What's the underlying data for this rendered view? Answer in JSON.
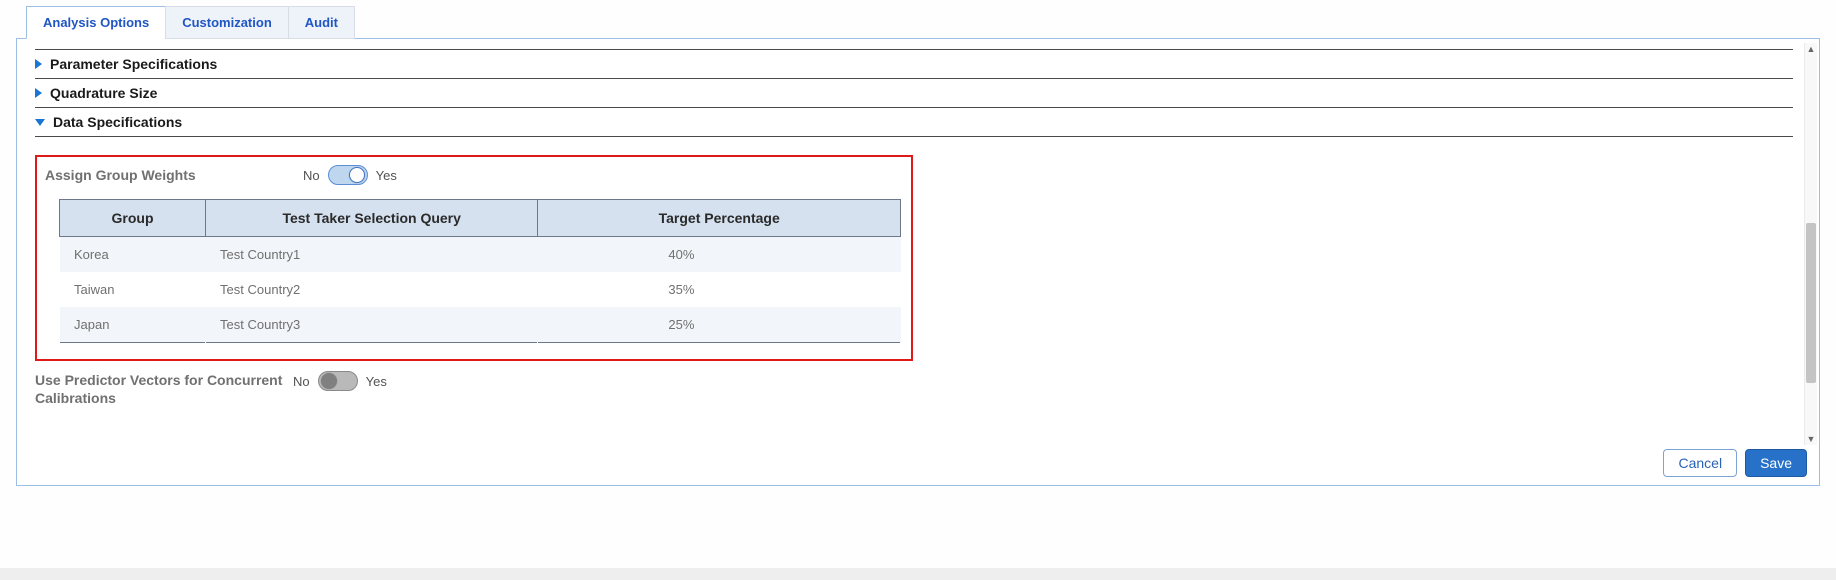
{
  "tabs": [
    {
      "label": "Analysis Options",
      "active": true
    },
    {
      "label": "Customization",
      "active": false
    },
    {
      "label": "Audit",
      "active": false
    }
  ],
  "accordion": {
    "param_spec": "Parameter Specifications",
    "quad_size": "Quadrature Size",
    "data_spec": "Data Specifications"
  },
  "assign_weights": {
    "label": "Assign Group Weights",
    "no": "No",
    "yes": "Yes",
    "enabled": true
  },
  "table": {
    "headers": {
      "group": "Group",
      "query": "Test Taker Selection Query",
      "pct": "Target Percentage"
    },
    "rows": [
      {
        "group": "Korea",
        "query": "Test Country1",
        "pct": "40%"
      },
      {
        "group": "Taiwan",
        "query": "Test Country2",
        "pct": "35%"
      },
      {
        "group": "Japan",
        "query": "Test Country3",
        "pct": "25%"
      }
    ]
  },
  "predictor": {
    "label": "Use Predictor Vectors for Concurrent Calibrations",
    "no": "No",
    "yes": "Yes",
    "enabled": false
  },
  "buttons": {
    "cancel": "Cancel",
    "save": "Save"
  }
}
